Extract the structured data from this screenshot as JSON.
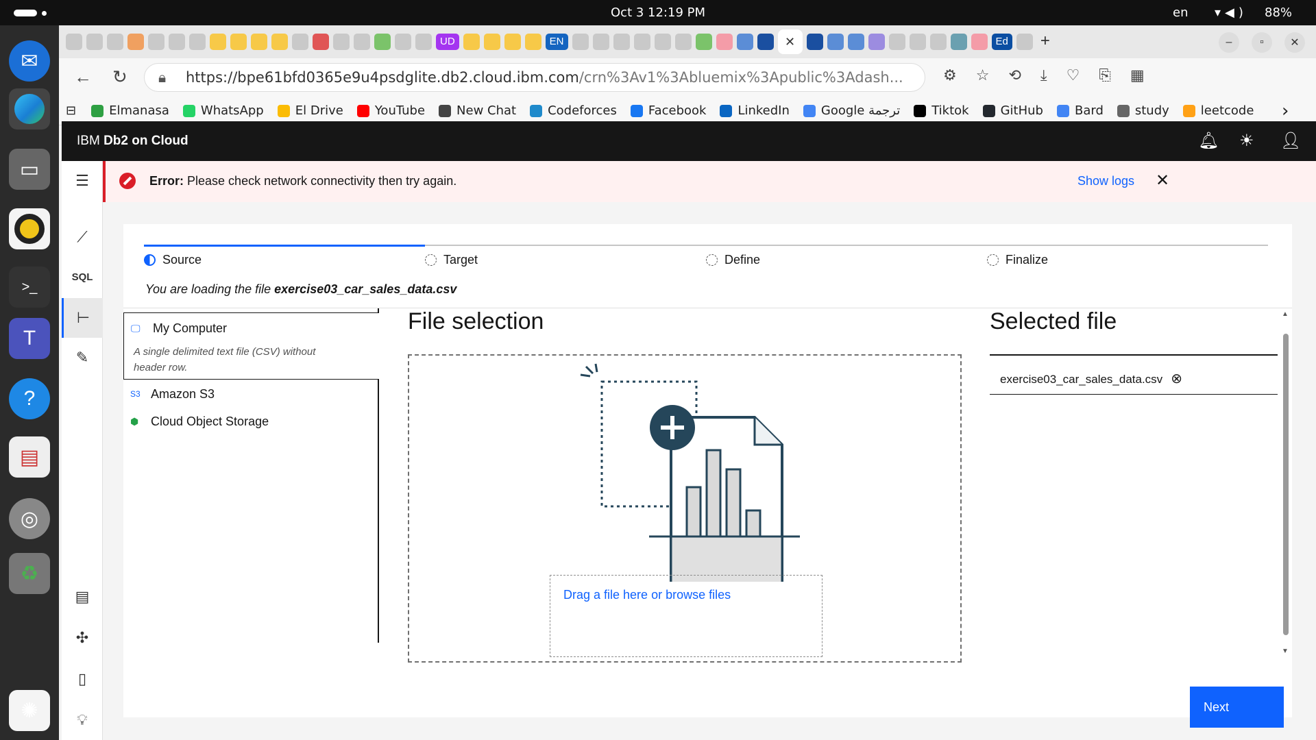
{
  "system_bar": {
    "clock": "Oct 3  12:19 PM",
    "lang": "en",
    "battery": "88%"
  },
  "browser": {
    "url_main": "https://bpe61bfd0365e9u4psdglite.db2.cloud.ibm.com",
    "url_rest": "/crn%3Av1%3Abluemix%3Apublic%3Adash...",
    "tab_labels": {
      "ud": "UD",
      "en": "EN",
      "ed": "Ed"
    },
    "bookmarks": [
      {
        "label": "Elmanasa",
        "color": "#2ea043"
      },
      {
        "label": "WhatsApp",
        "color": "#25d366"
      },
      {
        "label": "El Drive",
        "color": "#fbbc04"
      },
      {
        "label": "YouTube",
        "color": "#ff0000"
      },
      {
        "label": "New Chat",
        "color": "#444444"
      },
      {
        "label": "Codeforces",
        "color": "#1f8acb"
      },
      {
        "label": "Facebook",
        "color": "#1877f2"
      },
      {
        "label": "LinkedIn",
        "color": "#0a66c2"
      },
      {
        "label": "Google ترجمة",
        "color": "#4285f4"
      },
      {
        "label": "Tiktok",
        "color": "#000000"
      },
      {
        "label": "GitHub",
        "color": "#24292f"
      },
      {
        "label": "Bard",
        "color": "#4285f4"
      },
      {
        "label": "study",
        "color": "#666666"
      },
      {
        "label": "leetcode",
        "color": "#ffa116"
      }
    ]
  },
  "app": {
    "brand_prefix": "IBM",
    "brand_name": "Db2 on Cloud",
    "error": {
      "label": "Error:",
      "message": " Please check network connectivity then try again.",
      "show_logs": "Show logs"
    },
    "steps": [
      "Source",
      "Target",
      "Define",
      "Finalize"
    ],
    "loading_prefix": "You are loading the file ",
    "loading_file": "exercise03_car_sales_data.csv",
    "sources": {
      "my_computer": "My Computer",
      "my_computer_desc": "A single delimited text file (CSV) without header row.",
      "amazon": "Amazon S3",
      "amazon_badge": "S3",
      "cos": "Cloud Object Storage"
    },
    "file_selection_title": "File selection",
    "drop_text": "Drag a file here or browse files",
    "selected_title": "Selected file",
    "selected_file": "exercise03_car_sales_data.csv",
    "next_label": "Next"
  },
  "colors": {
    "accent": "#0f62fe",
    "error": "#da1e28",
    "error_bg": "#fff1f1",
    "header": "#161616"
  }
}
